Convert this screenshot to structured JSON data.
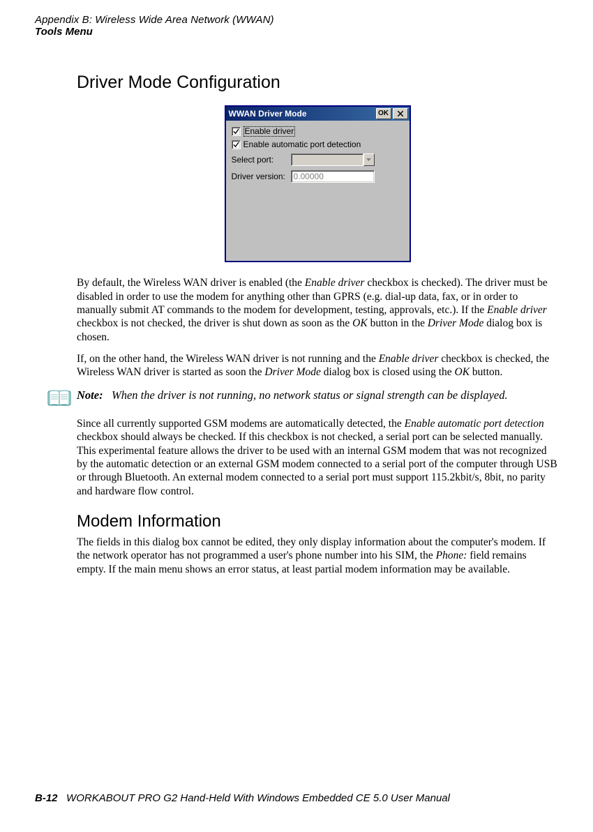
{
  "header": {
    "line1": "Appendix B: Wireless Wide Area Network (WWAN)",
    "line2": "Tools Menu"
  },
  "sections": {
    "driverMode": {
      "heading": "Driver Mode Configuration",
      "dialog": {
        "title": "WWAN Driver Mode",
        "okLabel": "OK",
        "checkbox1": "Enable driver",
        "checkbox2": "Enable automatic port detection",
        "selectPortLabel": "Select port:",
        "driverVerLabel": "Driver version:",
        "driverVerValue": "0.00000"
      },
      "para1_a": "By default, the Wireless WAN driver is enabled (the ",
      "para1_it1": "Enable driver",
      "para1_b": " checkbox is checked). The driver must be disabled in order to use the modem for anything other than GPRS (e.g. dial-up data, fax, or in order to manually submit AT commands to the modem for development, testing, approvals, etc.). If the ",
      "para1_it2": "Enable driver",
      "para1_c": " checkbox is not checked, the driver is shut down as soon as the ",
      "para1_it3": "OK",
      "para1_d": " button in the ",
      "para1_it4": "Driver Mode",
      "para1_e": " dialog box is chosen.",
      "para2_a": "If, on the other hand, the Wireless WAN driver is not running and the ",
      "para2_it1": "Enable driver",
      "para2_b": " checkbox is checked, the Wireless WAN driver is started as soon the ",
      "para2_it2": "Driver Mode",
      "para2_c": " dialog box is closed using the ",
      "para2_it3": "OK",
      "para2_d": " button.",
      "note_label": "Note:",
      "note_text": "When the driver is not running, no network status or signal strength can be displayed.",
      "para3_a": "Since all currently supported GSM modems are automatically detected, the ",
      "para3_it1": "Enable automatic port detection",
      "para3_b": " checkbox should always be checked. If this checkbox is not checked, a serial port can be selected manually. This experimental feature allows the driver to be used with an internal GSM modem that was not recognized by the automatic detection or an external GSM modem connected to a serial port of the computer through USB or through Bluetooth. An external modem connected to a serial port must support 115.2kbit/s, 8bit, no parity and hardware flow control."
    },
    "modemInfo": {
      "heading": "Modem Information",
      "para_a": "The fields in this dialog box cannot be edited, they only display information about the computer's modem. If the network operator has not programmed a user's phone number into his SIM, the ",
      "para_it1": "Phone:",
      "para_b": " field remains empty. If the main menu shows an error status, at least partial modem information may be available."
    }
  },
  "footer": {
    "pageNum": "B-12",
    "text": "WORKABOUT PRO G2 Hand-Held With Windows Embedded CE 5.0 User Manual"
  }
}
